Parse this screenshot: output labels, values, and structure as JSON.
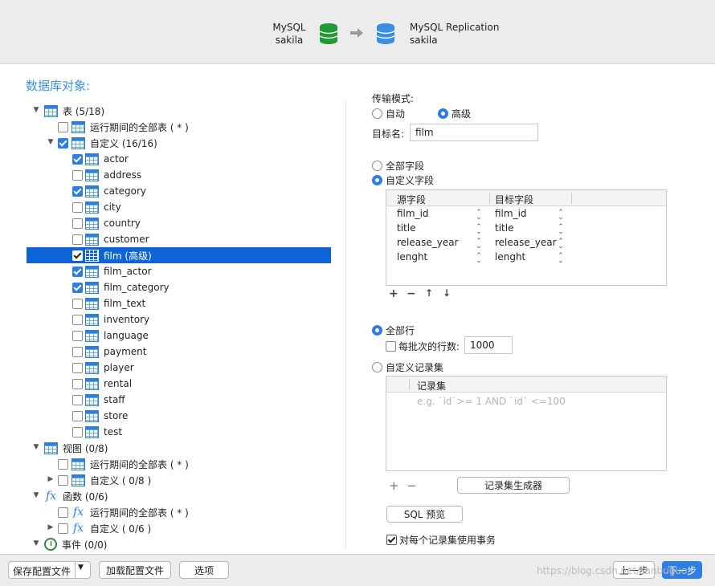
{
  "header": {
    "source": {
      "name": "MySQL",
      "db": "sakila"
    },
    "target": {
      "name": "MySQL Replication",
      "db": "sakila"
    }
  },
  "left": {
    "section_title": "数据库对象:",
    "tables_node": "表 (5/18)",
    "tables_runtime_all": "运行期间的全部表 ( * )",
    "tables_custom": "自定义 (16/16)",
    "table_items": [
      {
        "label": "actor",
        "checked": true
      },
      {
        "label": "address",
        "checked": false
      },
      {
        "label": "category",
        "checked": true
      },
      {
        "label": "city",
        "checked": false
      },
      {
        "label": "country",
        "checked": false
      },
      {
        "label": "customer",
        "checked": false
      },
      {
        "label": "film (高级)",
        "checked": true,
        "selected": true
      },
      {
        "label": "film_actor",
        "checked": true
      },
      {
        "label": "film_category",
        "checked": true
      },
      {
        "label": "film_text",
        "checked": false
      },
      {
        "label": "inventory",
        "checked": false
      },
      {
        "label": "language",
        "checked": false
      },
      {
        "label": "payment",
        "checked": false
      },
      {
        "label": "player",
        "checked": false
      },
      {
        "label": "rental",
        "checked": false
      },
      {
        "label": "staff",
        "checked": false
      },
      {
        "label": "store",
        "checked": false
      },
      {
        "label": "test",
        "checked": false
      }
    ],
    "views_node": "视图 (0/8)",
    "views_runtime_all": "运行期间的全部表 ( * )",
    "views_custom": "自定义 ( 0/8 )",
    "functions_node": "函数 (0/6)",
    "functions_runtime_all": "运行期间的全部表 ( * )",
    "functions_custom": "自定义 ( 0/6 )",
    "events_node": "事件 (0/0)"
  },
  "right": {
    "transfer_mode_label": "传输模式:",
    "mode_auto": "自动",
    "mode_advanced": "高级",
    "target_name_label": "目标名:",
    "target_name_value": "film",
    "all_fields": "全部字段",
    "custom_fields": "自定义字段",
    "col_source": "源字段",
    "col_target": "目标字段",
    "field_rows": [
      {
        "source": "film_id",
        "target": "film_id"
      },
      {
        "source": "title",
        "target": "title"
      },
      {
        "source": "release_year",
        "target": "release_year"
      },
      {
        "source": "lenght",
        "target": "lenght"
      }
    ],
    "all_rows": "全部行",
    "rows_per_batch_label": "每批次的行数:",
    "rows_per_batch_value": "1000",
    "custom_recordset": "自定义记录集",
    "recordset_col": "记录集",
    "recordset_placeholder": "e.g. `id`>= 1 AND `id` <=100",
    "recordset_generator": "记录集生成器",
    "sql_preview": "SQL 预览",
    "use_transaction": "对每个记录集使用事务"
  },
  "footer": {
    "save_profile": "保存配置文件",
    "load_profile": "加载配置文件",
    "options": "选项",
    "prev": "上一步",
    "next": "下一步",
    "watermark": "https://blog.csdn.net/sanbuguo"
  },
  "colors": {
    "accent": "#2e7de3",
    "selected_row": "#0d64d8",
    "title_blue": "#3d8fe0",
    "source_db": "#1f9a35",
    "target_db": "#3a8fe3"
  }
}
